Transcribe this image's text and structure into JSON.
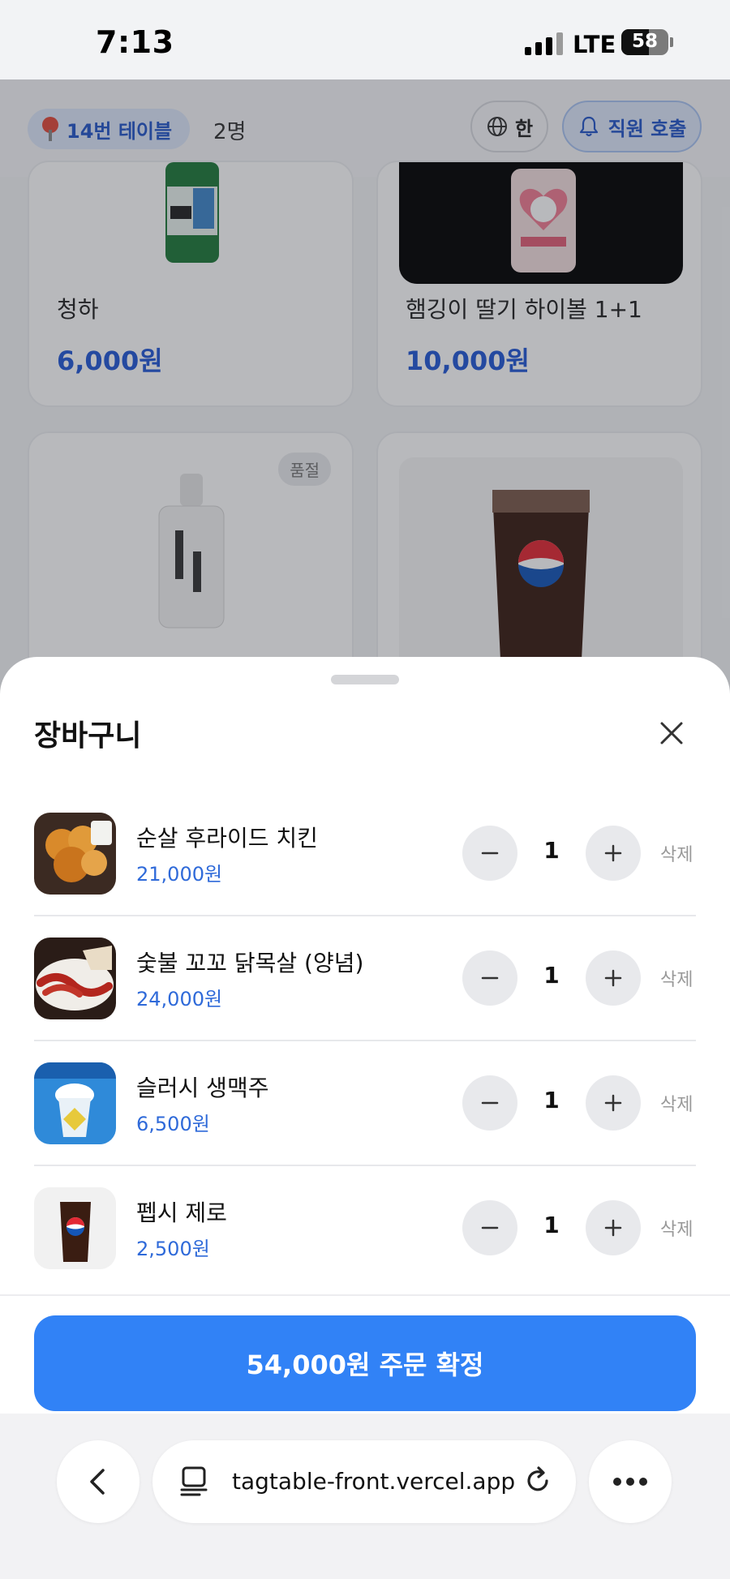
{
  "status_bar": {
    "time": "7:13",
    "network": "LTE",
    "battery": "58",
    "battery_level": 0.58
  },
  "header": {
    "table_label": "14번 테이블",
    "guests": "2명",
    "language_label": "한",
    "call_staff_label": "직원 호출"
  },
  "menu": {
    "items": [
      {
        "name": "청하",
        "price": "6,000원"
      },
      {
        "name": "햄깅이 딸기 하이볼 1+1",
        "price": "10,000원"
      },
      {
        "badge": "품절"
      }
    ]
  },
  "cart": {
    "title": "장바구니",
    "delete_label": "삭제",
    "items": [
      {
        "name": "순살 후라이드 치킨",
        "price": "21,000원",
        "quantity": "1"
      },
      {
        "name": "숯불 꼬꼬 닭목살 (양념)",
        "price": "24,000원",
        "quantity": "1"
      },
      {
        "name": "슬러시 생맥주",
        "price": "6,500원",
        "quantity": "1"
      },
      {
        "name": "펩시 제로",
        "price": "2,500원",
        "quantity": "1"
      }
    ],
    "order_button": "54,000원 주문 확정"
  },
  "browser": {
    "url": "tagtable-front.vercel.app"
  }
}
